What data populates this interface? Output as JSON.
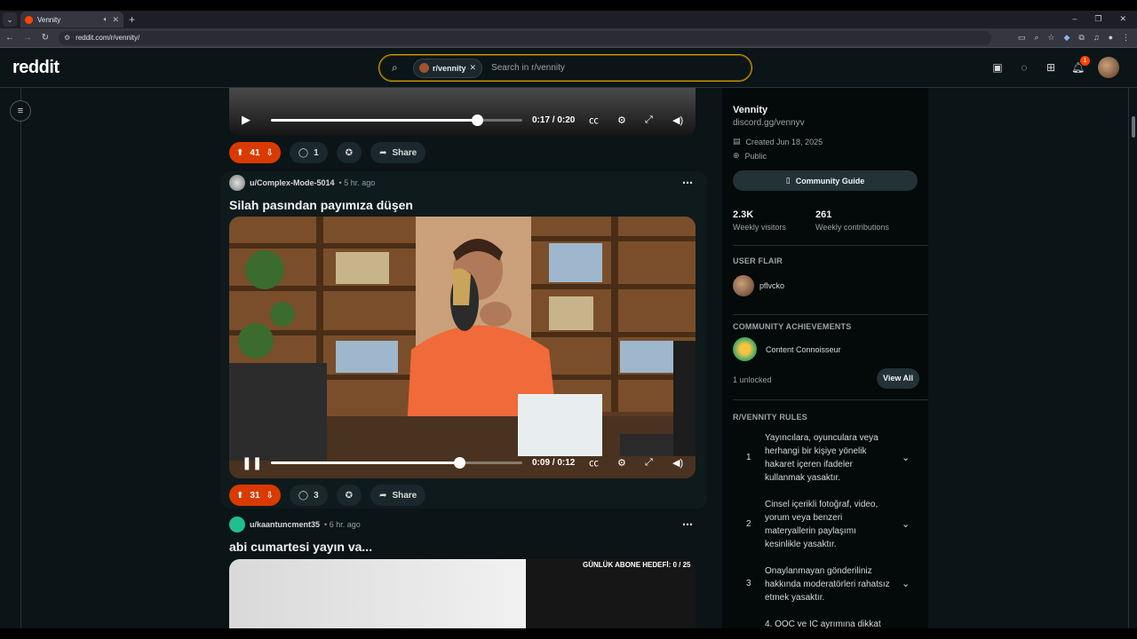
{
  "browser": {
    "tab_title": "Vennity",
    "url": "reddit.com/r/vennity/",
    "audio_icon": "speaker-icon",
    "win_min": "–",
    "win_restore": "❐",
    "win_close": "✕"
  },
  "header": {
    "logo": "reddit",
    "search_chip": "r/vennity",
    "search_placeholder": "Search in r/vennity",
    "notification_count": "1"
  },
  "posts": [
    {
      "player": {
        "time": "0:17 / 0:20",
        "progress": 0.82,
        "state": "paused"
      },
      "votes": "41",
      "comments": "1",
      "share_label": "Share"
    },
    {
      "author": "u/Complex-Mode-5014",
      "time": "5 hr. ago",
      "title": "Silah pasından payımıza düşen",
      "player": {
        "time": "0:09 / 0:12",
        "progress": 0.75,
        "state": "playing"
      },
      "votes": "31",
      "comments": "3",
      "share_label": "Share"
    },
    {
      "author": "u/kaantuncment35",
      "time": "6 hr. ago",
      "title": "abi cumartesi yayın va...",
      "video_overlay": "GÜNLÜK ABONE HEDEFİ: 0 / 25"
    }
  ],
  "sidebar": {
    "name": "Vennity",
    "link": "discord.gg/vennyv",
    "created": "Created Jun 18, 2025",
    "visibility": "Public",
    "guide_button": "Community Guide",
    "stats": [
      {
        "value": "2.3K",
        "label": "Weekly visitors"
      },
      {
        "value": "261",
        "label": "Weekly contributions"
      }
    ],
    "user_flair_heading": "USER FLAIR",
    "flair_user": "pflvcko",
    "achievements_heading": "COMMUNITY ACHIEVEMENTS",
    "achievement": "Content Connoisseur",
    "unlocked": "1 unlocked",
    "view_all": "View All",
    "rules_heading": "R/VENNITY RULES",
    "rules": [
      {
        "num": "1",
        "text": "Yayıncılara, oyunculara veya herhangi bir kişiye yönelik hakaret içeren ifadeler kullanmak yasaktır."
      },
      {
        "num": "2",
        "text": "Cinsel içerikli fotoğraf, video, yorum veya benzeri materyallerin paylaşımı kesinlikle yasaktır."
      },
      {
        "num": "3",
        "text": "Onaylanmayan gönderiliniz hakkında moderatörleri rahatsız etmek yasaktır."
      },
      {
        "num": "",
        "text": "4. OOC ve IC ayrımına dikkat"
      }
    ]
  }
}
